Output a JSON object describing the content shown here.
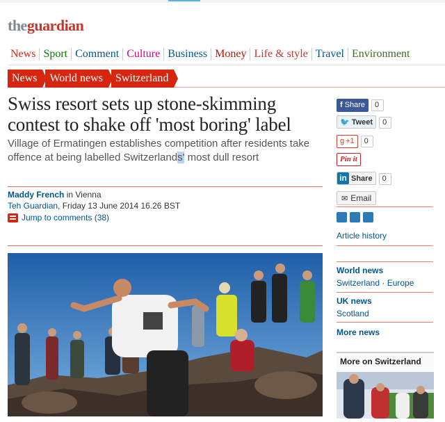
{
  "masthead": {
    "the": "the",
    "guardian": "guardian"
  },
  "nav": [
    {
      "label": "News",
      "color": "#d6260f"
    },
    {
      "label": "Sport",
      "color": "#008000"
    },
    {
      "label": "Comment",
      "color": "#005689"
    },
    {
      "label": "Culture",
      "color": "#d1008b"
    },
    {
      "label": "Business",
      "color": "#005689"
    },
    {
      "label": "Money",
      "color": "#b51800"
    },
    {
      "label": "Life & style",
      "color": "#c0392b"
    },
    {
      "label": "Travel",
      "color": "#005689"
    },
    {
      "label": "Environment",
      "color": "#3d6c1c"
    }
  ],
  "breadcrumbs": [
    "News",
    "World news",
    "Switzerland"
  ],
  "article": {
    "headline": "Swiss resort sets up stone-skimming contest to shake off 'most boring' label",
    "standfirst_before": "Village of Ermatingen establishes competition after residents take offence at being labelled Switzerland",
    "standfirst_sel": "s'",
    "standfirst_after": " most dull resort",
    "author": "Maddy French",
    "author_location": " in Vienna",
    "publication": "Teh Guardian",
    "date": ", Friday 13 June 2014 16.26 BST",
    "jump_comments": "Jump to comments (38)"
  },
  "social": {
    "facebook": {
      "label": "Share",
      "count": "0"
    },
    "twitter": {
      "label": "Tweet",
      "count": "0"
    },
    "gplus": {
      "label": "+1",
      "count": "0"
    },
    "pinterest": {
      "label": "Pin it"
    },
    "linkedin": {
      "icon": "in",
      "label": "Share",
      "count": "0"
    },
    "email": {
      "label": "Email"
    }
  },
  "sidebar": {
    "article_history": "Article history",
    "world_news": "World news",
    "world_news_tags": [
      "Switzerland",
      "Europe"
    ],
    "tag_sep": " · ",
    "uk_news": "UK news",
    "uk_news_tags": [
      "Scotland"
    ],
    "more_news": "More news",
    "more_on": "More on Switzerland"
  }
}
